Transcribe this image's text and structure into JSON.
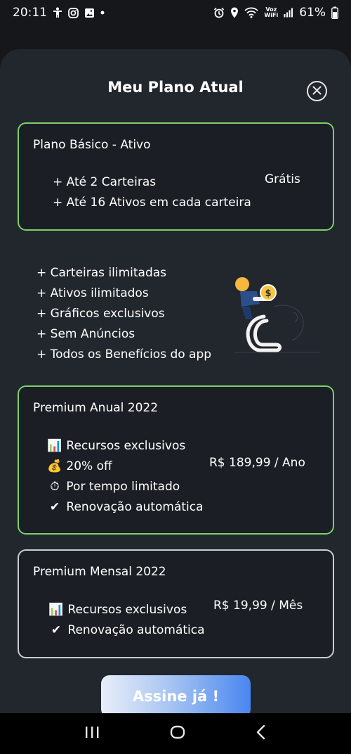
{
  "status_bar": {
    "time": "20:11",
    "battery": "61%",
    "voz_label": "Voz",
    "wifi_label": "WiFi"
  },
  "sheet": {
    "title": "Meu Plano Atual"
  },
  "current_plan": {
    "title": "Plano Básico - Ativo",
    "features": [
      "+ Até 2 Carteiras",
      "+ Até 16 Ativos em cada carteira"
    ],
    "price": "Grátis"
  },
  "benefits": [
    "+ Carteiras ilimitadas",
    "+ Ativos ilimitados",
    "+ Gráficos exclusivos",
    "+ Sem Anúncios",
    "+ Todos os Benefícios do app"
  ],
  "annual_plan": {
    "title": "Premium Anual 2022",
    "features": [
      {
        "icon": "📊",
        "label": "Recursos exclusivos"
      },
      {
        "icon": "💰",
        "label": "20% off"
      },
      {
        "icon": "⏱",
        "label": "Por tempo limitado"
      },
      {
        "icon": "✔",
        "label": "Renovação automática"
      }
    ],
    "price": "R$ 189,99 / Ano"
  },
  "monthly_plan": {
    "title": "Premium Mensal 2022",
    "features": [
      {
        "icon": "📊",
        "label": "Recursos exclusivos"
      },
      {
        "icon": "✔",
        "label": "Renovação automática"
      }
    ],
    "price": "R$ 19,99 / Mês"
  },
  "cta": {
    "label": "Assine já !"
  },
  "colors": {
    "active_border": "#7ccf6a",
    "inactive_border": "#c9ccd2",
    "sheet_bg": "#22262d",
    "card_bg": "#1b1f25",
    "accent": "#4a86f0"
  }
}
